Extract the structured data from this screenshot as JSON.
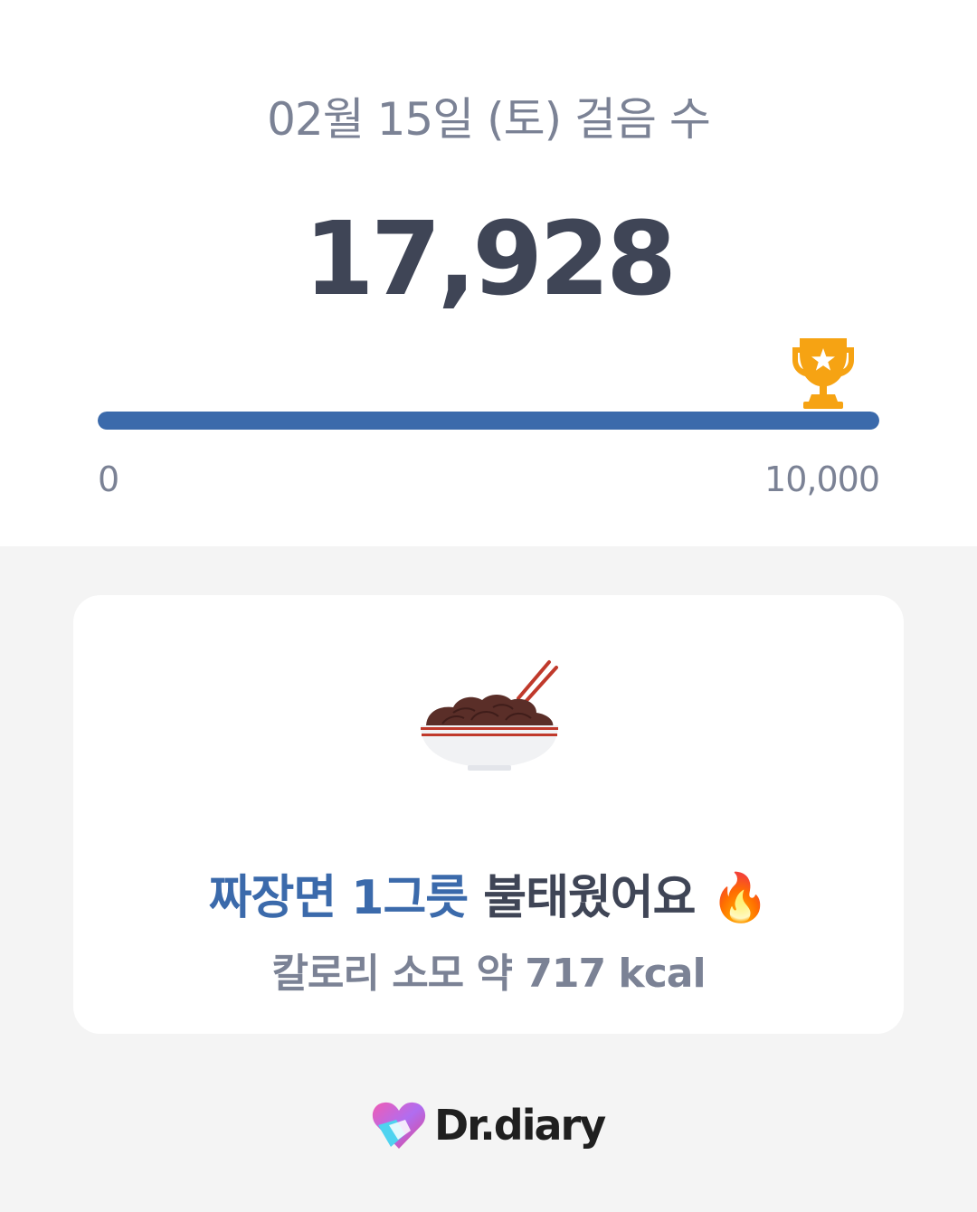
{
  "steps": {
    "date_label": "02월 15일 (토) 걸음 수",
    "count": "17,928",
    "goal_progress": 1.0,
    "scale_min": "0",
    "scale_max": "10,000"
  },
  "burn_card": {
    "food_name": "짜장면 1그릇",
    "burned_text": "불태웠어요",
    "emoji": "🔥",
    "calorie_text": "칼로리 소모 약 717 kcal"
  },
  "brand": {
    "name": "Dr.diary"
  },
  "colors": {
    "accent": "#3b6aab",
    "text_dark": "#3f4556",
    "text_muted": "#7b8295",
    "trophy": "#f6a313",
    "background": "#f4f4f4"
  },
  "icons": {
    "trophy": "trophy-icon",
    "food": "jjajangmyeon-bowl-icon",
    "fire": "fire-icon",
    "brand": "dr-diary-logo"
  }
}
